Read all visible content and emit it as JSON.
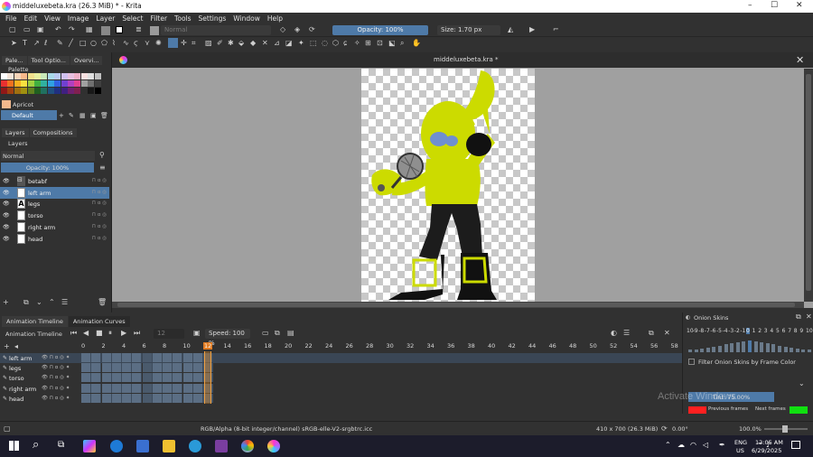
{
  "window": {
    "title": "middeluxebeta.kra (26.3 MiB)  * - Krita"
  },
  "menu": [
    "File",
    "Edit",
    "View",
    "Image",
    "Layer",
    "Select",
    "Filter",
    "Tools",
    "Settings",
    "Window",
    "Help"
  ],
  "toolbar": {
    "blend_mode": "Normal",
    "opacity_label": "Opacity: 100%",
    "size_label": "Size: 1.70 px"
  },
  "left_tabs": [
    "Pale...",
    "Tool Optio...",
    "Overvi..."
  ],
  "palette": {
    "title": "Palette",
    "current_color": "Apricot",
    "palette_name": "Default"
  },
  "layers_tabs": [
    "Layers",
    "Compositions"
  ],
  "layers": {
    "title": "Layers",
    "blend": "Normal",
    "opacity": "Opacity: 100%",
    "items": [
      {
        "name": "betabf",
        "kind": "group"
      },
      {
        "name": "left arm",
        "kind": "paint"
      },
      {
        "name": "legs",
        "kind": "vector"
      },
      {
        "name": "torso",
        "kind": "paint"
      },
      {
        "name": "right arm",
        "kind": "paint"
      },
      {
        "name": "head",
        "kind": "paint"
      }
    ]
  },
  "document_tab": "middeluxebeta.kra *",
  "timeline": {
    "tabs": [
      "Animation Timeline",
      "Animation Curves"
    ],
    "title": "Animation Timeline",
    "frame_field": "12",
    "speed": "Speed: 100 %",
    "frames": [
      "0",
      "2",
      "4",
      "6",
      "8",
      "10",
      "12",
      "14",
      "16",
      "18",
      "20",
      "22",
      "24",
      "26",
      "28",
      "30",
      "32",
      "34",
      "36",
      "38",
      "40",
      "42",
      "44",
      "46",
      "48",
      "50",
      "52",
      "54",
      "56",
      "58"
    ],
    "rows": [
      "left arm",
      "legs",
      "torso",
      "right arm",
      "head"
    ]
  },
  "onion": {
    "title": "Onion Skins",
    "numbers": [
      "10",
      "-9",
      "-8",
      "-7",
      "-6",
      "-5",
      "-4",
      "-3",
      "-2",
      "-1",
      "0",
      "1",
      "2",
      "3",
      "4",
      "5",
      "6",
      "7",
      "8",
      "9",
      "10"
    ],
    "filter": "Filter Onion Skins by Frame Color",
    "tint": "Tint: 75.00%",
    "prev": "Previous frames",
    "next": "Next frames",
    "prev_color": "#ff2020",
    "next_color": "#10e010"
  },
  "watermark": "Activate Windows",
  "status": {
    "color_space": "RGB/Alpha (8-bit integer/channel)  sRGB-elle-V2-srgbtrc.icc",
    "dims": "410 x 700 (26.3 MiB)",
    "rotation": "0.00°",
    "zoom": "100.0%"
  },
  "taskbar": {
    "lang1": "ENG",
    "lang2": "US",
    "time": "12:05 AM",
    "date": "6/29/2025"
  }
}
